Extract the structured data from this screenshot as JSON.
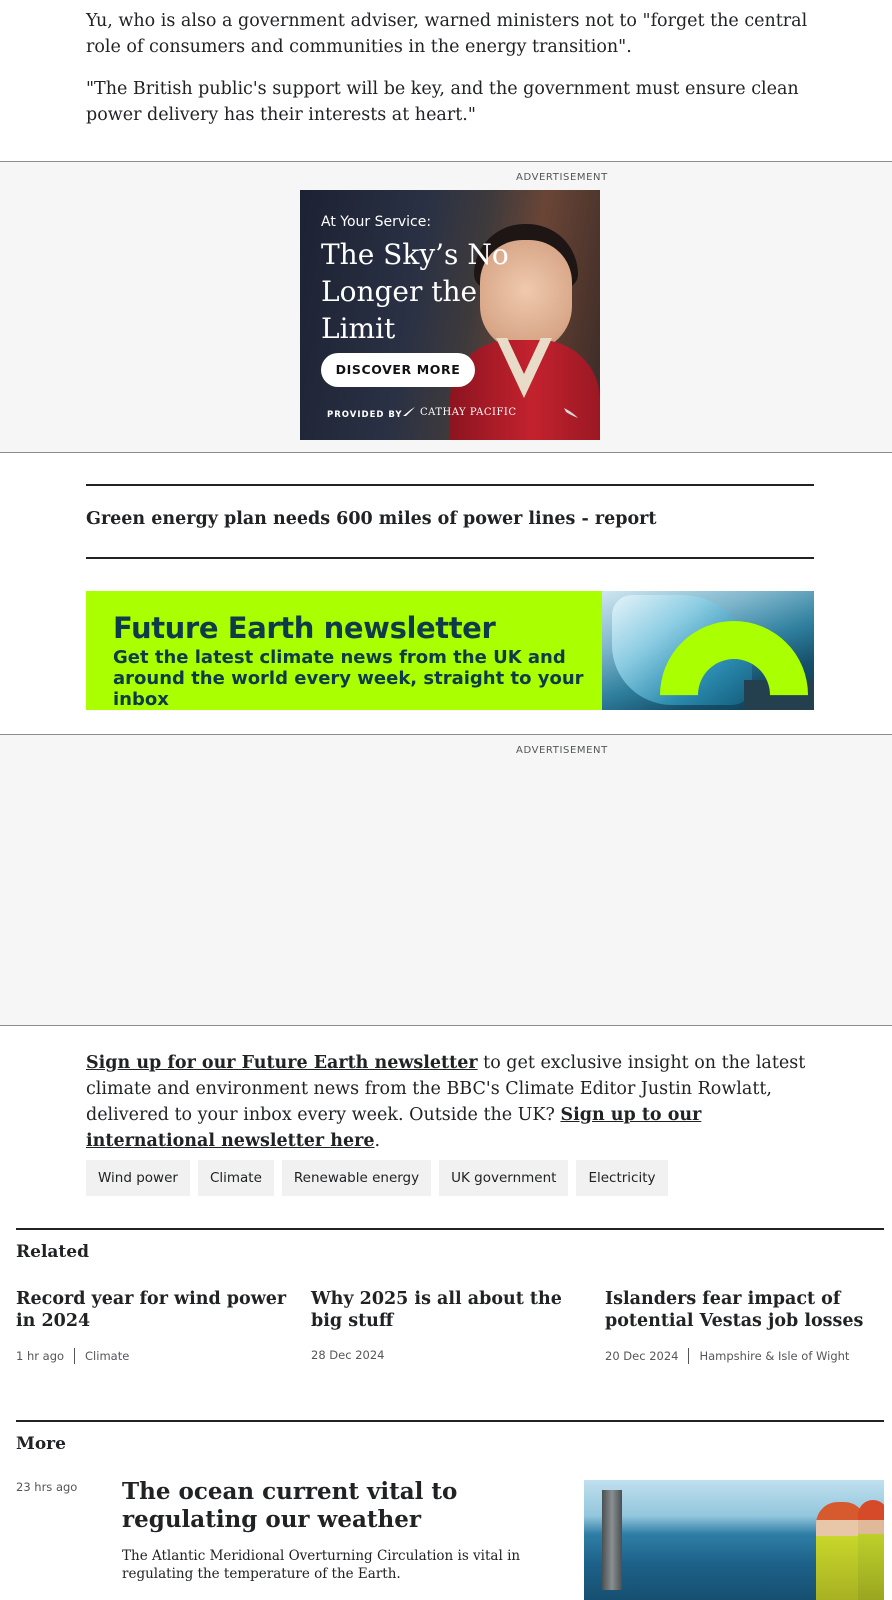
{
  "article": {
    "paragraph_1": "Yu, who is also a government adviser, warned ministers not to \"forget the central role of consumers and communities in the energy transition\".",
    "paragraph_2": "\"The British public's support will be key, and the government must ensure clean power delivery has their interests at heart.\""
  },
  "ads": {
    "label": "ADVERTISEMENT",
    "creative": {
      "eyebrow": "At Your Service:",
      "headline": "The Sky’s No Longer the Limit",
      "cta": "DISCOVER MORE",
      "provided_by": "PROVIDED BY",
      "brand": "CATHAY PACIFIC"
    }
  },
  "related_link": {
    "title": "Green energy plan needs 600 miles of power lines - report"
  },
  "newsletter_banner": {
    "title": "Future Earth newsletter",
    "subtitle": "Get the latest climate news from the UK and around the world every week, straight to your inbox"
  },
  "newsletter_para": {
    "link1": "Sign up for our Future Earth newsletter",
    "text1": " to get exclusive insight on the latest climate and environment news from the BBC's Climate Editor Justin Rowlatt, delivered to your inbox every week. Outside the UK? ",
    "link2": "Sign up to our international newsletter here",
    "text2": "."
  },
  "tags": [
    "Wind power",
    "Climate",
    "Renewable energy",
    "UK government",
    "Electricity"
  ],
  "related": {
    "title": "Related",
    "items": [
      {
        "title": "Record year for wind power in 2024",
        "time": "1 hr ago",
        "section": "Climate"
      },
      {
        "title": "Why 2025 is all about the big stuff",
        "time": "28 Dec 2024",
        "section": ""
      },
      {
        "title": "Islanders fear impact of potential Vestas job losses",
        "time": "20 Dec 2024",
        "section": "Hampshire & Isle of Wight"
      }
    ]
  },
  "more": {
    "title": "More",
    "item": {
      "time": "23 hrs ago",
      "title": "The ocean current vital to regulating our weather",
      "description": "The Atlantic Meridional Overturning Circulation is vital in regulating the temperature of the Earth."
    }
  },
  "colors": {
    "text": "#202224",
    "meta": "#545658",
    "banner_bg": "#aaff00",
    "banner_text": "#0e3b4a",
    "ad_band": "#f6f6f6"
  }
}
